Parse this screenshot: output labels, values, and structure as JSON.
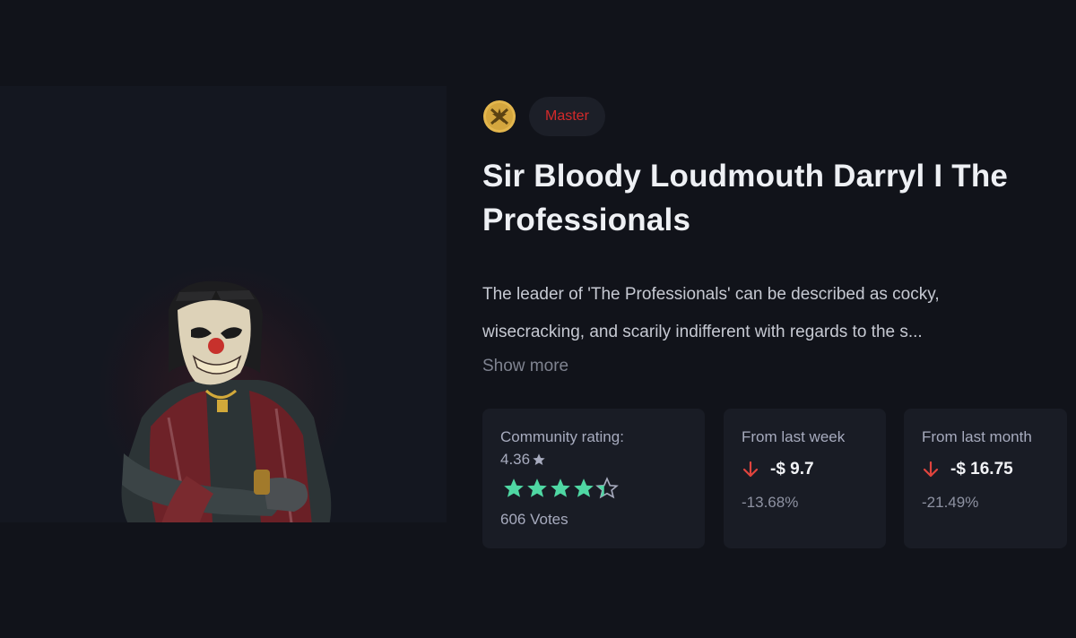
{
  "item": {
    "rarity": "Master",
    "title": "Sir Bloody Loudmouth Darryl I The Professionals",
    "description": "The leader of 'The Professionals' can be described as cocky, wisecracking, and scarily indifferent with regards to the s...",
    "show_more_label": "Show more"
  },
  "rating": {
    "label": "Community rating:",
    "value": "4.36",
    "stars_filled_fraction": 0.872,
    "votes": "606 Votes",
    "star_color": "#4fd7a3"
  },
  "changes": {
    "week": {
      "label": "From last week",
      "amount": "-$ 9.7",
      "percent": "-13.68%"
    },
    "month": {
      "label": "From last month",
      "amount": "-$ 16.75",
      "percent": "-21.49%"
    }
  },
  "colors": {
    "background": "#11131a",
    "card": "#191c25",
    "rarity_red": "#d42a2a",
    "arrow_red": "#e0443e",
    "rank_gold": "#e3b64d"
  },
  "icons": {
    "rank": "rank-emblem-icon",
    "down": "arrow-down-icon",
    "star": "star-icon"
  }
}
